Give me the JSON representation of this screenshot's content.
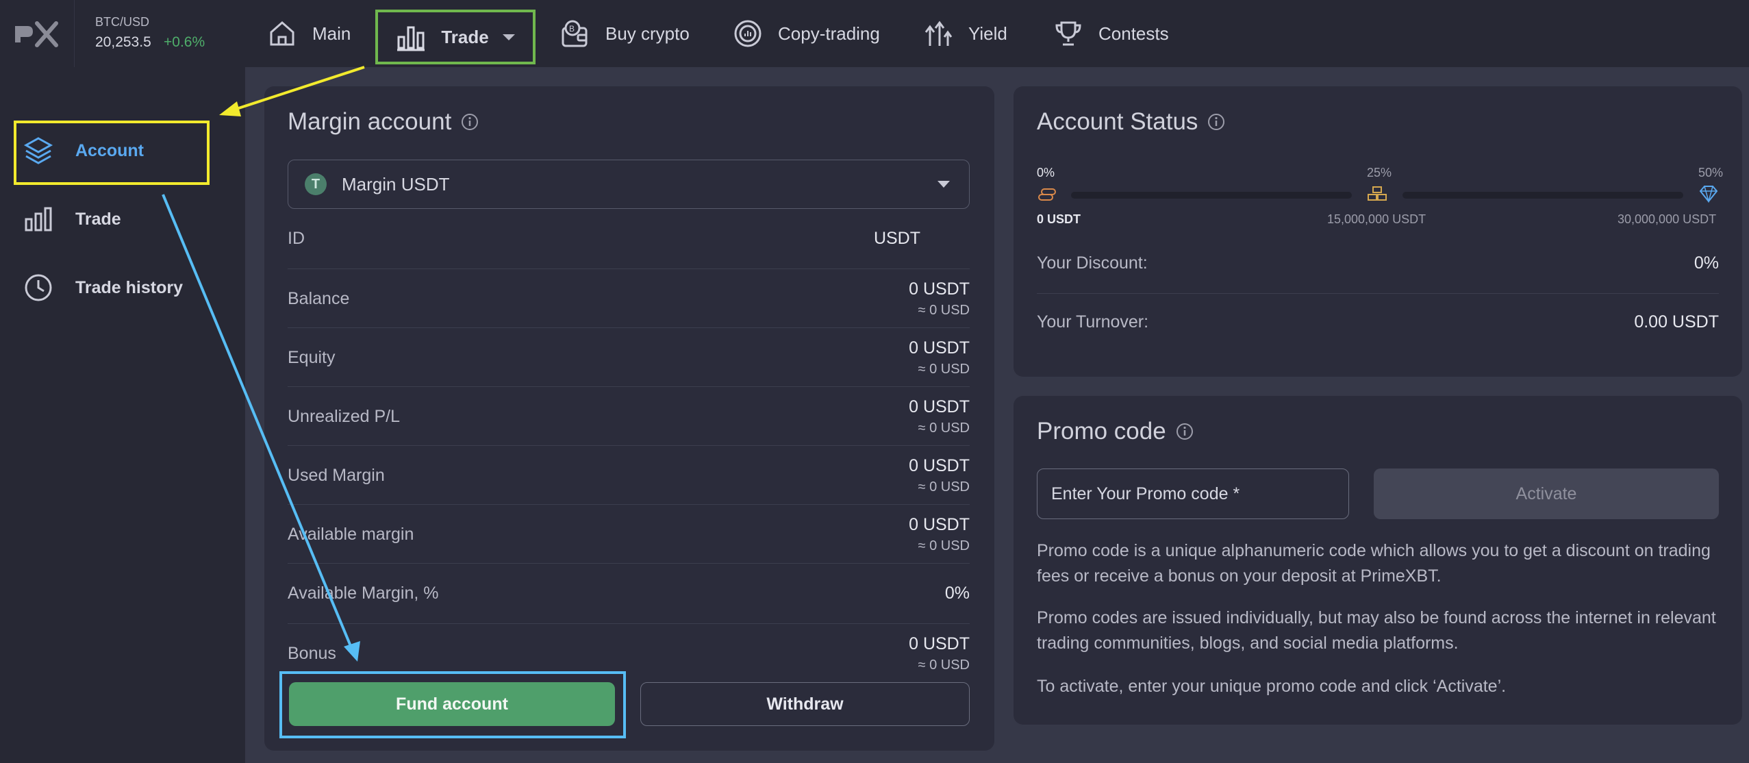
{
  "ticker": {
    "pair": "BTC/USD",
    "price": "20,253.5",
    "change": "+0.6%"
  },
  "nav": {
    "main": "Main",
    "trade": "Trade",
    "buy_crypto": "Buy crypto",
    "copy_trading": "Copy-trading",
    "yield": "Yield",
    "contests": "Contests"
  },
  "sidebar": {
    "items": [
      {
        "label": "Account",
        "icon": "layers-icon",
        "active": true
      },
      {
        "label": "Trade",
        "icon": "bar-chart-icon",
        "active": false
      },
      {
        "label": "Trade history",
        "icon": "clock-icon",
        "active": false
      }
    ]
  },
  "margin": {
    "title": "Margin account",
    "selected_account": "Margin USDT",
    "rows": [
      {
        "label": "ID",
        "value": "USDT",
        "sub": ""
      },
      {
        "label": "Balance",
        "value": "0 USDT",
        "sub": "≈ 0 USD"
      },
      {
        "label": "Equity",
        "value": "0 USDT",
        "sub": "≈ 0 USD"
      },
      {
        "label": "Unrealized P/L",
        "value": "0 USDT",
        "sub": "≈ 0 USD"
      },
      {
        "label": "Used Margin",
        "value": "0 USDT",
        "sub": "≈ 0 USD"
      },
      {
        "label": "Available margin",
        "value": "0 USDT",
        "sub": "≈ 0 USD"
      },
      {
        "label": "Available Margin, %",
        "value": "0%",
        "sub": ""
      },
      {
        "label": "Bonus",
        "value": "0 USDT",
        "sub": "≈ 0 USD"
      }
    ],
    "fund_label": "Fund account",
    "withdraw_label": "Withdraw"
  },
  "status": {
    "title": "Account Status",
    "levels": [
      {
        "pct": "0%",
        "amount": "0 USDT"
      },
      {
        "pct": "25%",
        "amount": "15,000,000 USDT"
      },
      {
        "pct": "50%",
        "amount": "30,000,000 USDT"
      }
    ],
    "discount_label": "Your Discount:",
    "discount_value": "0%",
    "turnover_label": "Your Turnover:",
    "turnover_value": "0.00 USDT"
  },
  "promo": {
    "title": "Promo code",
    "placeholder": "Enter Your Promo code *",
    "activate_label": "Activate",
    "paragraphs": [
      "Promo code is a unique alphanumeric code which allows you to get a discount on trading fees or receive a bonus on your deposit at PrimeXBT.",
      "Promo codes are issued individually, but may also be found across the internet in relevant trading communities, blogs, and social media platforms.",
      "To activate, enter your unique promo code and click ‘Activate’."
    ]
  },
  "colors": {
    "accent_blue": "#5aa9f0",
    "green": "#4f9f6b",
    "annotation_yellow": "#f2ea2d",
    "annotation_blue": "#57bdf4",
    "annotation_green": "#70b84e"
  }
}
